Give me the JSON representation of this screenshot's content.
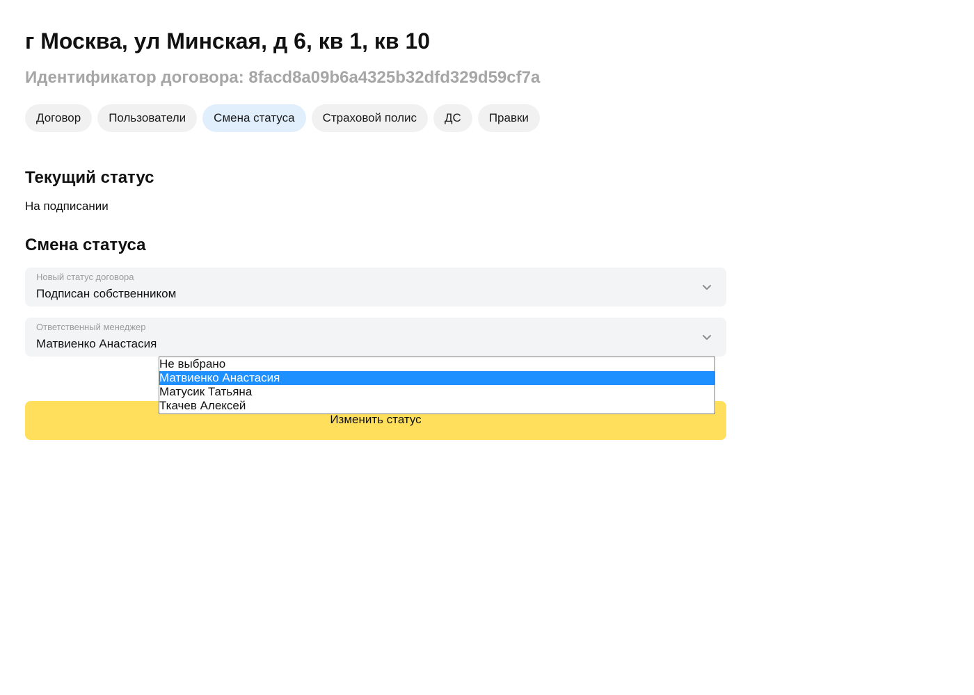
{
  "header": {
    "title": "г Москва, ул Минская, д 6, кв 1, кв 10",
    "contract_id": "Идентификатор договора: 8facd8a09b6a4325b32dfd329d59cf7a"
  },
  "tabs": [
    {
      "label": "Договор",
      "active": false
    },
    {
      "label": "Пользователи",
      "active": false
    },
    {
      "label": "Смена статуса",
      "active": true
    },
    {
      "label": "Страховой полис",
      "active": false
    },
    {
      "label": "ДС",
      "active": false
    },
    {
      "label": "Правки",
      "active": false
    }
  ],
  "current_status": {
    "heading": "Текущий статус",
    "value": "На подписании"
  },
  "status_change": {
    "heading": "Смена статуса",
    "new_status": {
      "label": "Новый статус договора",
      "value": "Подписан собственником"
    },
    "manager": {
      "label": "Ответственный менеджер",
      "value": "Матвиенко Анастасия",
      "options": [
        {
          "label": "Не выбрано",
          "selected": false
        },
        {
          "label": "Матвиенко Анастасия",
          "selected": true
        },
        {
          "label": "Матусик Татьяна",
          "selected": false
        },
        {
          "label": "Ткачев Алексей",
          "selected": false
        }
      ]
    },
    "submit_label": "Изменить статус"
  },
  "colors": {
    "accent_button": "#ffdf5c",
    "active_tab": "#e1eefc",
    "tab": "#f1f1f1",
    "field_bg": "#f3f4f6",
    "dropdown_highlight": "#1e90ff",
    "muted_text": "#a6a6a6"
  },
  "icons": {
    "select_chevron": "chevron-down-icon"
  }
}
